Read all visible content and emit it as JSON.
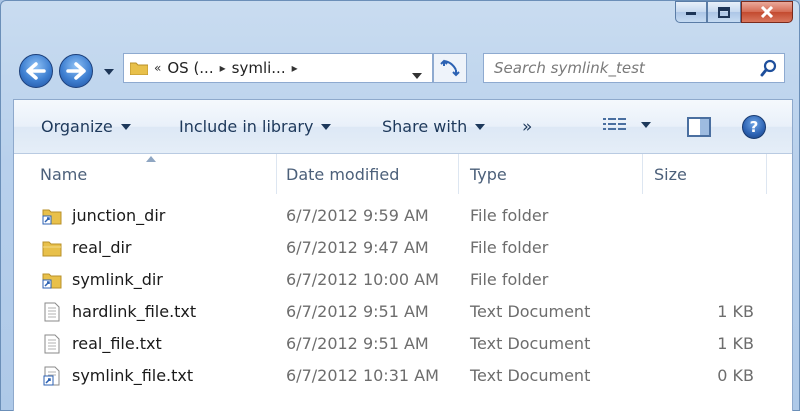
{
  "window": {
    "minimize_icon": "minimize-icon",
    "maximize_icon": "maximize-icon",
    "close_icon": "close-icon"
  },
  "address_bar": {
    "crumb_overflow": "«",
    "crumb_drive": "OS (...",
    "crumb_folder": "symli...",
    "separator": "▸"
  },
  "search": {
    "placeholder": "Search symlink_test"
  },
  "toolbar": {
    "organize_label": "Organize",
    "include_label": "Include in library",
    "share_label": "Share with",
    "more_label": "»",
    "help_label": "?"
  },
  "columns": {
    "name": "Name",
    "date": "Date modified",
    "type": "Type",
    "size": "Size"
  },
  "files": [
    {
      "name": "junction_dir",
      "date": "6/7/2012 9:59 AM",
      "type": "File folder",
      "size": "",
      "icon": "folder-shortcut-icon"
    },
    {
      "name": "real_dir",
      "date": "6/7/2012 9:47 AM",
      "type": "File folder",
      "size": "",
      "icon": "folder-icon"
    },
    {
      "name": "symlink_dir",
      "date": "6/7/2012 10:00 AM",
      "type": "File folder",
      "size": "",
      "icon": "folder-shortcut-icon"
    },
    {
      "name": "hardlink_file.txt",
      "date": "6/7/2012 9:51 AM",
      "type": "Text Document",
      "size": "1 KB",
      "icon": "text-file-icon"
    },
    {
      "name": "real_file.txt",
      "date": "6/7/2012 9:51 AM",
      "type": "Text Document",
      "size": "1 KB",
      "icon": "text-file-icon"
    },
    {
      "name": "symlink_file.txt",
      "date": "6/7/2012 10:31 AM",
      "type": "Text Document",
      "size": "0 KB",
      "icon": "text-file-shortcut-icon"
    }
  ],
  "colors": {
    "accent": "#2c62b3",
    "folder": "#e8c04a",
    "close": "#c94a2f"
  }
}
